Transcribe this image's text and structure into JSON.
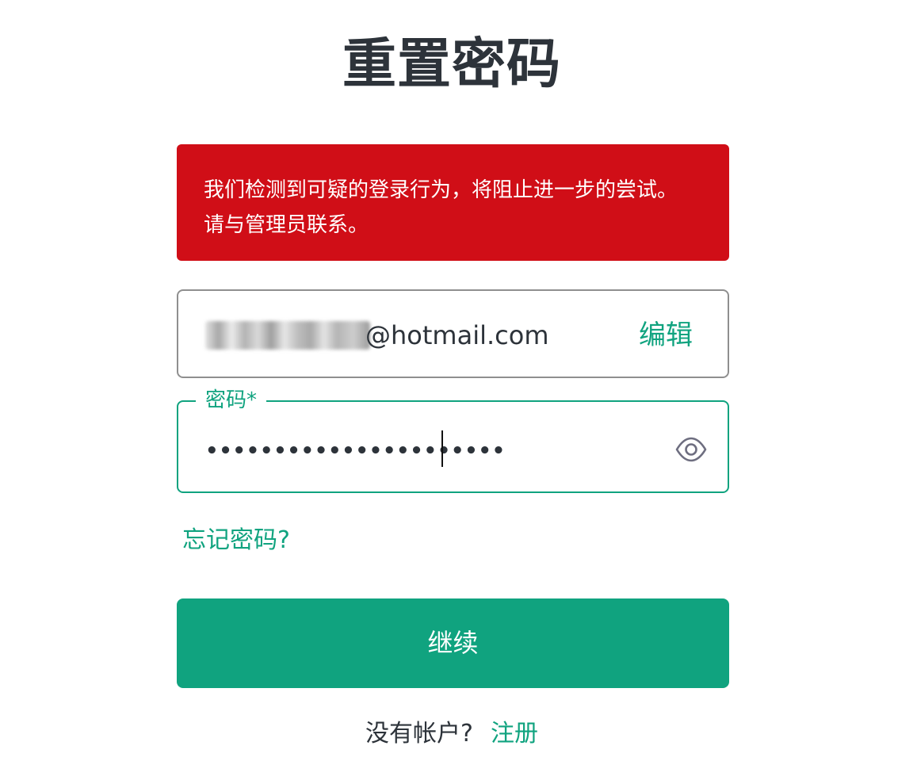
{
  "page": {
    "title": "重置密码"
  },
  "alert": {
    "message": "我们检测到可疑的登录行为，将阻止进一步的尝试。请与管理员联系。"
  },
  "email_field": {
    "value_visible_suffix": "@hotmail.com",
    "edit_label": "编辑"
  },
  "password_field": {
    "label": "密码*",
    "masked_value": "••••••••••••••••••••••"
  },
  "forgot_password": {
    "label": "忘记密码?"
  },
  "continue_button": {
    "label": "继续"
  },
  "signup": {
    "prompt": "没有帐户?",
    "link_label": "注册"
  },
  "colors": {
    "accent": "#10a37f",
    "error_background": "#d00e17",
    "text": "#2d333a"
  },
  "icons": {
    "password_toggle": "eye-icon"
  }
}
